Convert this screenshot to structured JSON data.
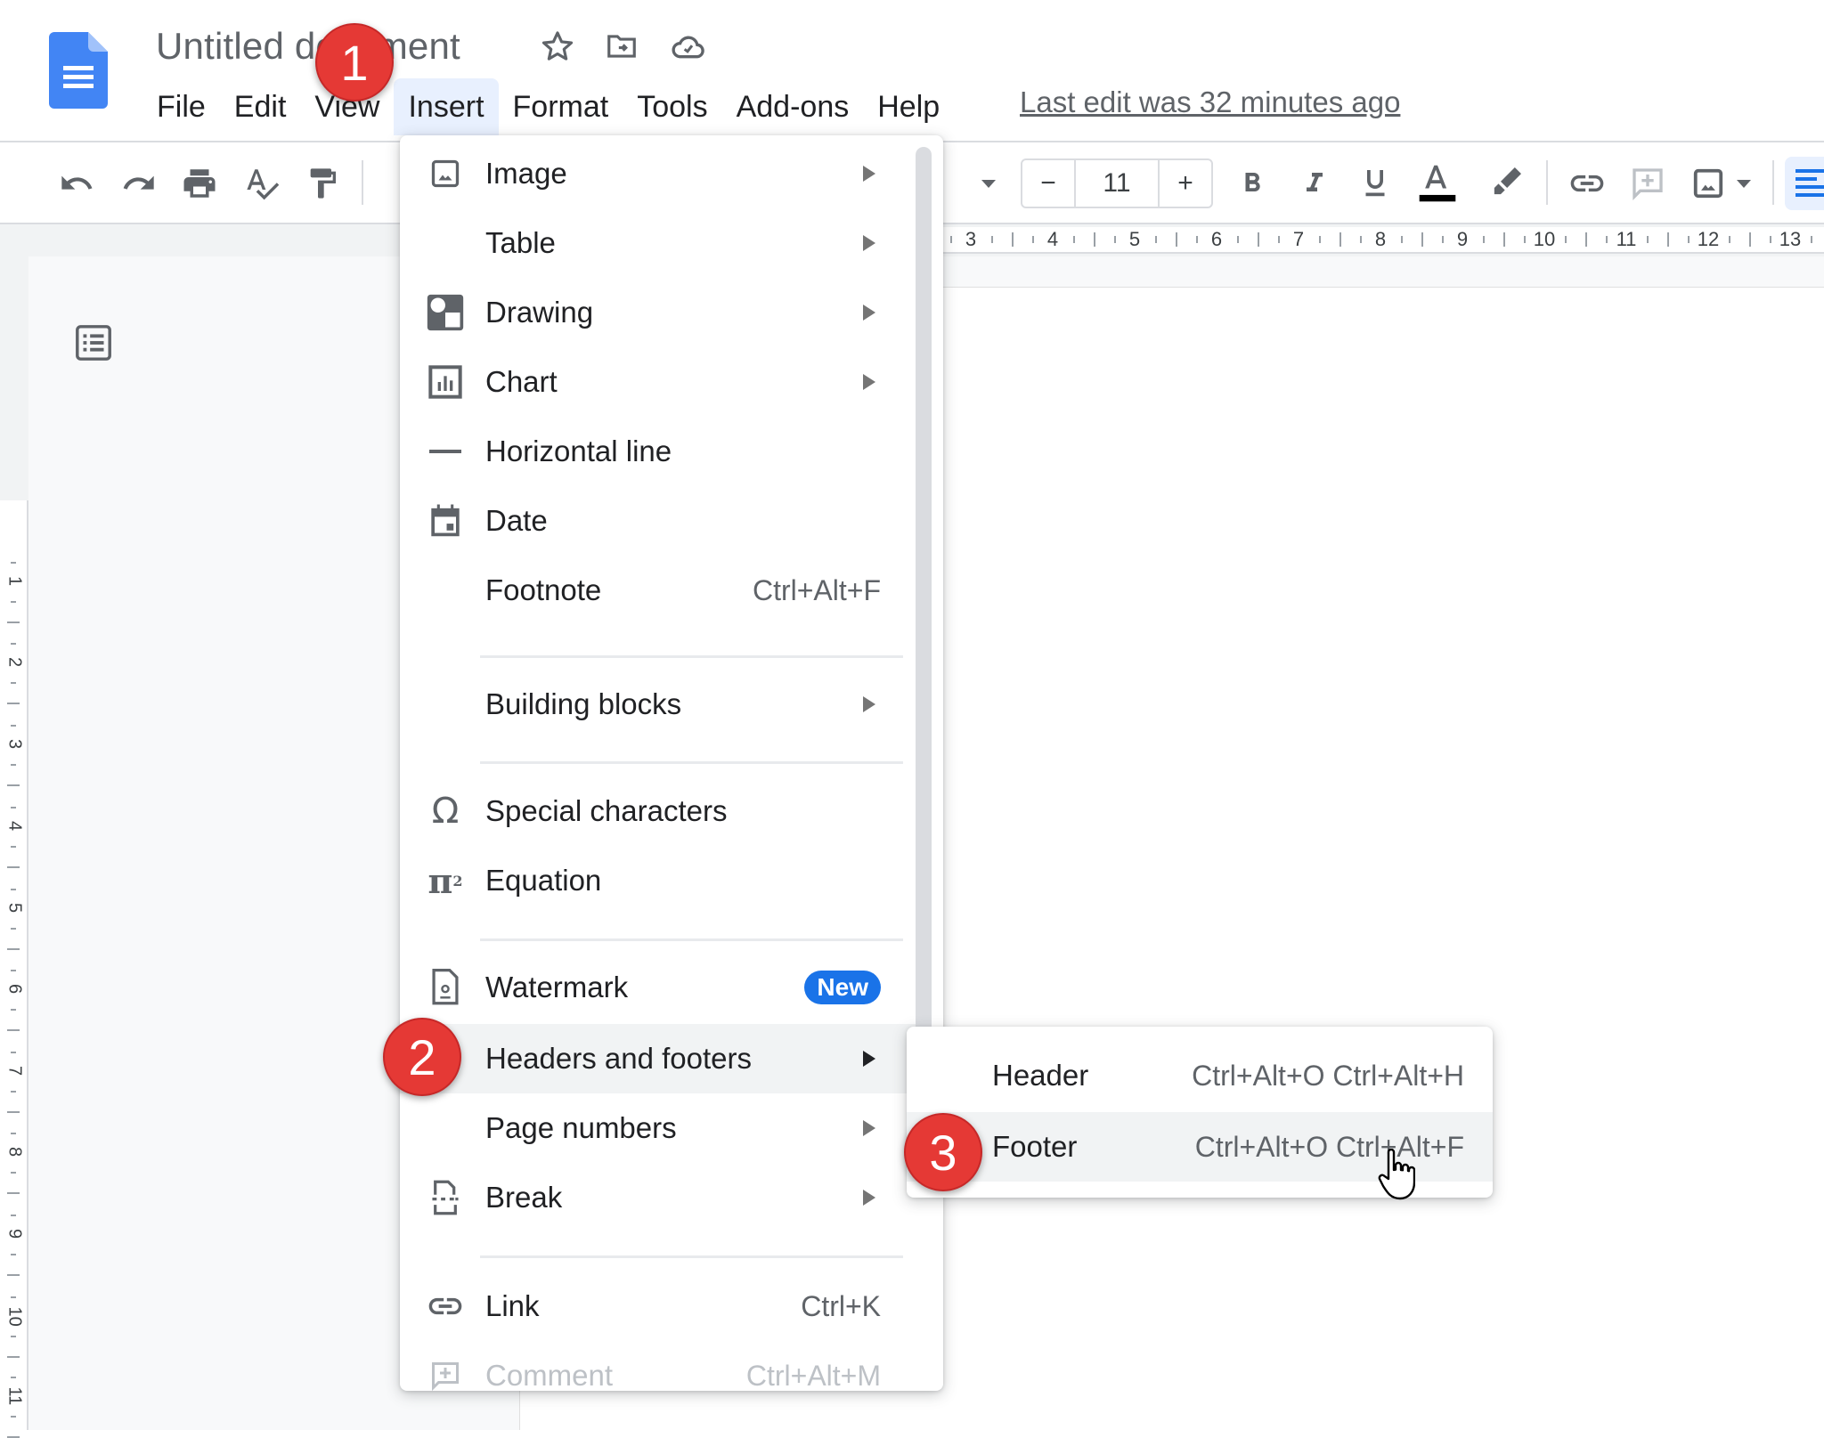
{
  "header": {
    "title": "Untitled document",
    "icons": [
      "star-icon",
      "move-to-folder-icon",
      "cloud-saved-icon"
    ],
    "menu": [
      "File",
      "Edit",
      "View",
      "Insert",
      "Format",
      "Tools",
      "Add-ons",
      "Help"
    ],
    "active_menu": "Insert",
    "last_edit": "Last edit was 32 minutes ago"
  },
  "toolbar": {
    "left_icons": [
      "undo-icon",
      "redo-icon",
      "print-icon",
      "spellcheck-icon",
      "paint-format-icon"
    ],
    "font_size": "11",
    "font_size_minus": "−",
    "font_size_plus": "+",
    "format_icons": [
      "bold-icon",
      "italic-icon",
      "underline-icon",
      "text-color-icon",
      "highlight-icon",
      "link-icon",
      "add-comment-icon",
      "insert-image-icon",
      "align-left-icon"
    ],
    "text_color": "#000000"
  },
  "ruler": {
    "horizontal": [
      "3",
      "4",
      "5",
      "6",
      "7",
      "8",
      "9",
      "10",
      "11",
      "12",
      "13"
    ],
    "vertical": [
      "2",
      "1",
      "1",
      "2",
      "3",
      "4",
      "5",
      "6",
      "7",
      "8",
      "9",
      "10",
      "11"
    ]
  },
  "insert_menu": {
    "items": [
      {
        "label": "Image",
        "icon": "image-icon",
        "submenu": true
      },
      {
        "label": "Table",
        "icon": "",
        "submenu": true
      },
      {
        "label": "Drawing",
        "icon": "drawing-icon",
        "submenu": true
      },
      {
        "label": "Chart",
        "icon": "chart-icon",
        "submenu": true
      },
      {
        "label": "Horizontal line",
        "icon": "horizontal-line-icon",
        "submenu": false
      },
      {
        "label": "Date",
        "icon": "calendar-icon",
        "submenu": false
      },
      {
        "label": "Footnote",
        "icon": "",
        "shortcut": "Ctrl+Alt+F"
      },
      {
        "label": "Building blocks",
        "icon": "",
        "submenu": true
      },
      {
        "label": "Special characters",
        "icon": "omega-icon",
        "submenu": false
      },
      {
        "label": "Equation",
        "icon": "pi-squared-icon",
        "submenu": false
      },
      {
        "label": "Watermark",
        "icon": "watermark-icon",
        "badge": "New"
      },
      {
        "label": "Headers and footers",
        "icon": "",
        "submenu": true,
        "highlighted": true
      },
      {
        "label": "Page numbers",
        "icon": "",
        "submenu": true
      },
      {
        "label": "Break",
        "icon": "break-icon",
        "submenu": true
      },
      {
        "label": "Link",
        "icon": "link-icon",
        "shortcut": "Ctrl+K"
      },
      {
        "label": "Comment",
        "icon": "comment-icon",
        "shortcut": "Ctrl+Alt+M",
        "disabled": true
      }
    ]
  },
  "submenu": {
    "items": [
      {
        "label": "Header",
        "shortcut": "Ctrl+Alt+O Ctrl+Alt+H"
      },
      {
        "label": "Footer",
        "shortcut": "Ctrl+Alt+O Ctrl+Alt+F",
        "highlighted": true
      }
    ]
  },
  "steps": [
    "1",
    "2",
    "3"
  ],
  "colors": {
    "accent": "#1a73e8",
    "step_badge": "#e53935",
    "hover": "#f1f3f4",
    "active_menu_bg": "#e8f0fe"
  }
}
